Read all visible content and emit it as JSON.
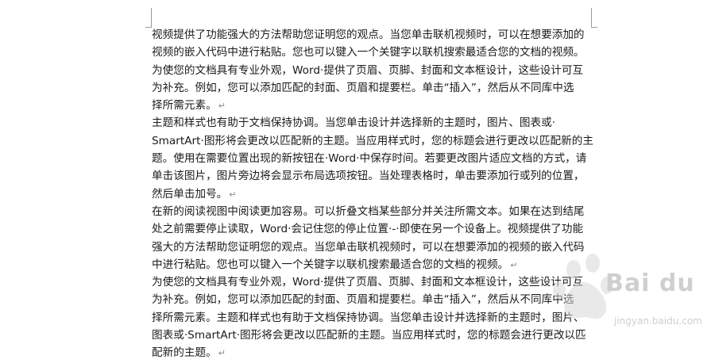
{
  "paragraphs": [
    [
      "视频提供了功能强大的方法帮助您证明您的观点。当您单击联机视频时，可以在想要添加的",
      "视频的嵌入代码中进行粘贴。您也可以键入一个关键字以联机搜索最适合您的文档的视频。",
      "为使您的文档具有专业外观，Word·提供了页眉、页脚、封面和文本框设计，这些设计可互",
      "为补充。例如，您可以添加匹配的封面、页眉和提要栏。单击“插入”，然后从不同库中选",
      "择所需元素。"
    ],
    [
      "主题和样式也有助于文档保持协调。当您单击设计并选择新的主题时，图片、图表或·",
      "SmartArt·图形将会更改以匹配新的主题。当应用样式时，您的标题会进行更改以匹配新的主",
      "题。使用在需要位置出现的新按钮在·Word·中保存时间。若要更改图片适应文档的方式，请",
      "单击该图片，图片旁边将会显示布局选项按钮。当处理表格时，单击要添加行或列的位置，",
      "然后单击加号。"
    ],
    [
      "在新的阅读视图中阅读更加容易。可以折叠文档某些部分并关注所需文本。如果在达到结尾",
      "处之前需要停止读取，Word·会记住您的停止位置·-·即使在另一个设备上。视频提供了功能",
      "强大的方法帮助您证明您的观点。当您单击联机视频时，可以在想要添加的视频的嵌入代码",
      "中进行粘贴。您也可以键入一个关键字以联机搜索最适合您的文档的视频。"
    ],
    [
      "为使您的文档具有专业外观，Word·提供了页眉、页脚、封面和文本框设计，这些设计可互",
      "为补充。例如，您可以添加匹配的封面、页眉和提要栏。单击“插入”，然后从不同库中选",
      "择所需元素。主题和样式也有助于文档保持协调。当您单击设计并选择新的主题时，图片、",
      "图表或·SmartArt·图形将会更改以匹配新的主题。当应用样式时，您的标题会进行更改以匹",
      "配新的主题。"
    ]
  ],
  "paragraph_mark": "↵",
  "watermark": {
    "brand": "Bai du",
    "site": "jingyan.baidu.com"
  }
}
